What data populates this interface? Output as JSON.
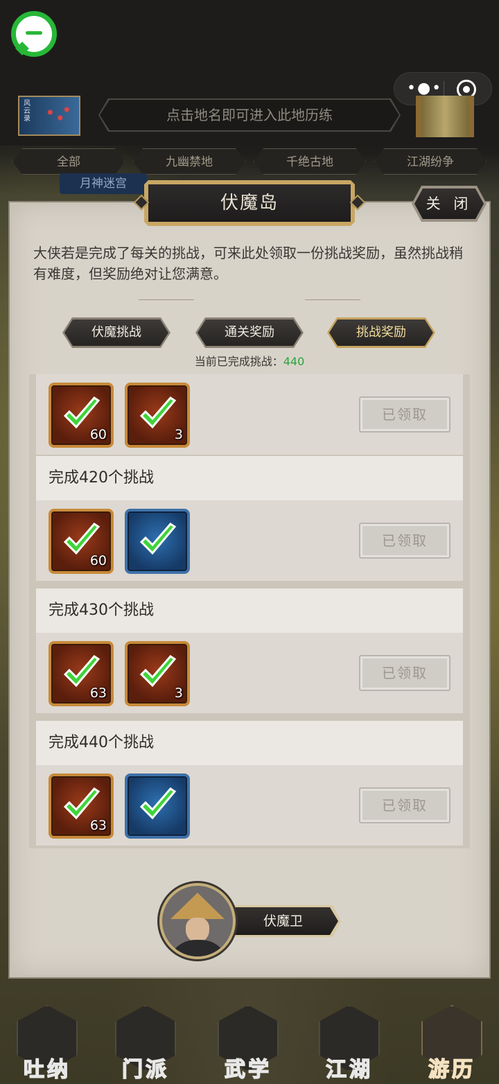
{
  "header": {
    "hint": "点击地名即可进入此地历练",
    "scroll_text": "风云录"
  },
  "categories": [
    "全部",
    "九幽禁地",
    "千绝古地",
    "江湖纷争"
  ],
  "chip": "月神迷宫",
  "panel": {
    "title": "伏魔岛",
    "close_label": "关 闭",
    "description": "大侠若是完成了每关的挑战，可来此处领取一份挑战奖励，虽然挑战稍有难度，但奖励绝对让您满意。",
    "tabs": [
      {
        "label": "伏魔挑战",
        "active": false
      },
      {
        "label": "通关奖励",
        "active": false
      },
      {
        "label": "挑战奖励",
        "active": true
      }
    ],
    "progress_label": "当前已完成挑战：",
    "progress_value": "440"
  },
  "rewards": [
    {
      "title": "",
      "items": [
        {
          "type": "red",
          "qty": "60"
        },
        {
          "type": "red",
          "qty": "3"
        }
      ],
      "status": "已领取"
    },
    {
      "title": "完成420个挑战",
      "items": [
        {
          "type": "red",
          "qty": "60"
        },
        {
          "type": "blue",
          "qty": ""
        }
      ],
      "status": "已领取"
    },
    {
      "title": "完成430个挑战",
      "items": [
        {
          "type": "red",
          "qty": "63"
        },
        {
          "type": "red",
          "qty": "3"
        }
      ],
      "status": "已领取"
    },
    {
      "title": "完成440个挑战",
      "items": [
        {
          "type": "red",
          "qty": "63"
        },
        {
          "type": "blue",
          "qty": ""
        }
      ],
      "status": "已领取"
    }
  ],
  "npc": {
    "name": "伏魔卫"
  },
  "bottom_nav": [
    {
      "label": "吐纳",
      "active": false
    },
    {
      "label": "门派",
      "active": false
    },
    {
      "label": "武学",
      "active": false
    },
    {
      "label": "江湖",
      "active": false
    },
    {
      "label": "游历",
      "active": true
    }
  ],
  "colors": {
    "accent_green": "#2aa43c",
    "gold": "#c5a35d",
    "app_logo": "#27b737"
  }
}
